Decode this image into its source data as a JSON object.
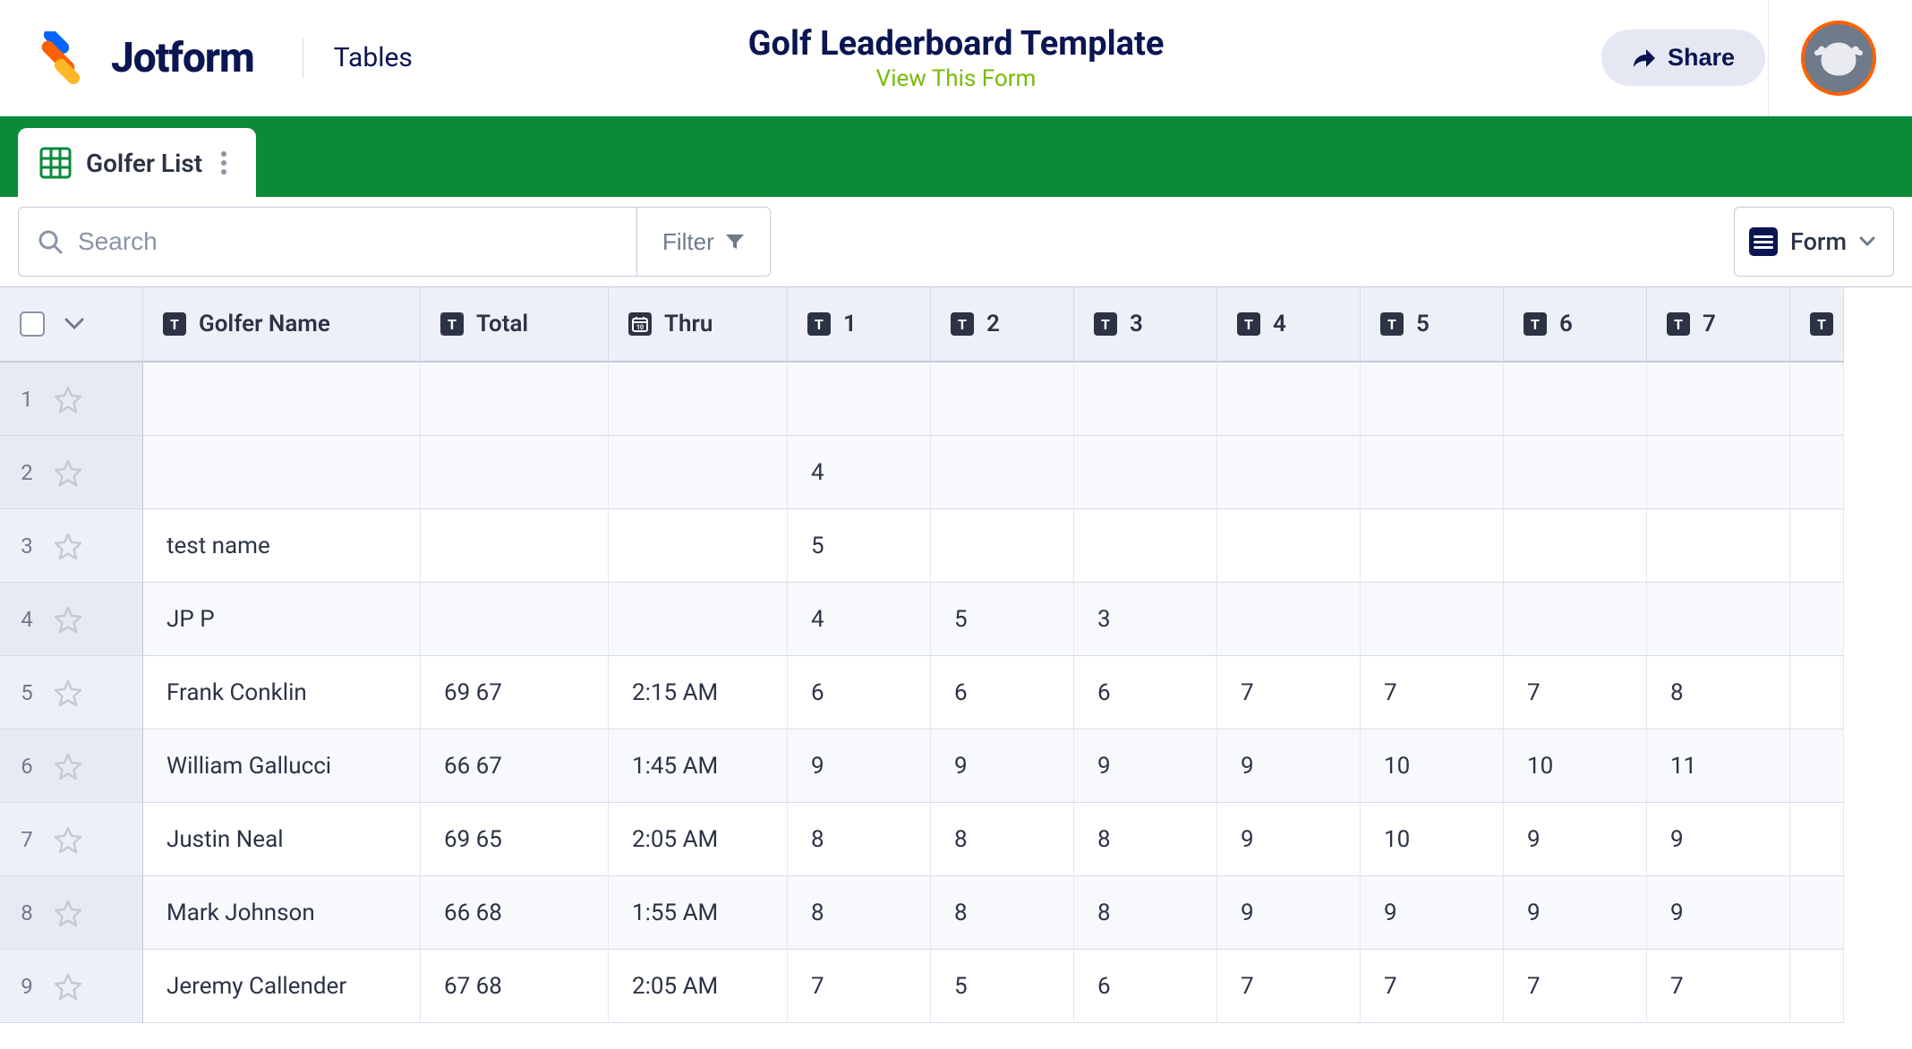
{
  "header": {
    "brand": "Jotform",
    "section": "Tables",
    "title": "Golf Leaderboard Template",
    "view_link": "View This Form",
    "share_label": "Share"
  },
  "tab": {
    "label": "Golfer List"
  },
  "toolbar": {
    "search_placeholder": "Search",
    "filter_label": "Filter",
    "form_label": "Form"
  },
  "columns": {
    "golfer_name": "Golfer Name",
    "total": "Total",
    "thru": "Thru",
    "h1": "1",
    "h2": "2",
    "h3": "3",
    "h4": "4",
    "h5": "5",
    "h6": "6",
    "h7": "7"
  },
  "rows": [
    {
      "n": "1",
      "name": "",
      "total": "",
      "thru": "",
      "c1": "",
      "c2": "",
      "c3": "",
      "c4": "",
      "c5": "",
      "c6": "",
      "c7": "",
      "shaded": true
    },
    {
      "n": "2",
      "name": "",
      "total": "",
      "thru": "",
      "c1": "4",
      "c2": "",
      "c3": "",
      "c4": "",
      "c5": "",
      "c6": "",
      "c7": "",
      "shaded": true
    },
    {
      "n": "3",
      "name": "test name",
      "total": "",
      "thru": "",
      "c1": "5",
      "c2": "",
      "c3": "",
      "c4": "",
      "c5": "",
      "c6": "",
      "c7": "",
      "shaded": false
    },
    {
      "n": "4",
      "name": "JP P",
      "total": "",
      "thru": "",
      "c1": "4",
      "c2": "5",
      "c3": "3",
      "c4": "",
      "c5": "",
      "c6": "",
      "c7": "",
      "shaded": true
    },
    {
      "n": "5",
      "name": "Frank Conklin",
      "total": "69 67",
      "thru": "2:15 AM",
      "c1": "6",
      "c2": "6",
      "c3": "6",
      "c4": "7",
      "c5": "7",
      "c6": "7",
      "c7": "8",
      "shaded": false
    },
    {
      "n": "6",
      "name": "William Gallucci",
      "total": "66 67",
      "thru": "1:45 AM",
      "c1": "9",
      "c2": "9",
      "c3": "9",
      "c4": "9",
      "c5": "10",
      "c6": "10",
      "c7": "11",
      "shaded": true
    },
    {
      "n": "7",
      "name": "Justin Neal",
      "total": "69 65",
      "thru": "2:05 AM",
      "c1": "8",
      "c2": "8",
      "c3": "8",
      "c4": "9",
      "c5": "10",
      "c6": "9",
      "c7": "9",
      "shaded": false
    },
    {
      "n": "8",
      "name": "Mark Johnson",
      "total": "66 68",
      "thru": "1:55 AM",
      "c1": "8",
      "c2": "8",
      "c3": "8",
      "c4": "9",
      "c5": "9",
      "c6": "9",
      "c7": "9",
      "shaded": true
    },
    {
      "n": "9",
      "name": "Jeremy Callender",
      "total": "67 68",
      "thru": "2:05 AM",
      "c1": "7",
      "c2": "5",
      "c3": "6",
      "c4": "7",
      "c5": "7",
      "c6": "7",
      "c7": "7",
      "shaded": false
    }
  ]
}
